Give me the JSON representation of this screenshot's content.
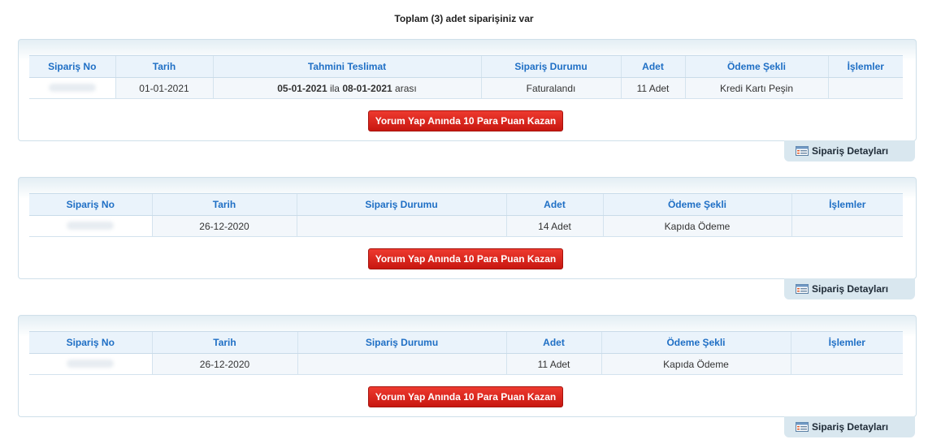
{
  "summary": "Toplam (3) adet siparişiniz var",
  "orders": [
    {
      "headers": [
        "Sipariş No",
        "Tarih",
        "Tahmini Teslimat",
        "Sipariş Durumu",
        "Adet",
        "Ödeme Şekli",
        "İşlemler"
      ],
      "row": {
        "order_no": "",
        "date": "01-01-2021",
        "delivery_start": "05-01-2021",
        "delivery_mid": " ila ",
        "delivery_end": "08-01-2021",
        "delivery_suffix": " arası",
        "status": "Faturalandı",
        "quantity": "11 Adet",
        "payment": "Kredi Kartı Peşin",
        "actions": ""
      },
      "promo_label": "Yorum Yap Anında 10 Para Puan Kazan",
      "details_label": "Sipariş Detayları"
    },
    {
      "headers": [
        "Sipariş No",
        "Tarih",
        "Sipariş Durumu",
        "Adet",
        "Ödeme Şekli",
        "İşlemler"
      ],
      "row": {
        "order_no": "",
        "date": "26-12-2020",
        "status": "",
        "quantity": "14 Adet",
        "payment": "Kapıda Ödeme",
        "actions": ""
      },
      "promo_label": "Yorum Yap Anında 10 Para Puan Kazan",
      "details_label": "Sipariş Detayları"
    },
    {
      "headers": [
        "Sipariş No",
        "Tarih",
        "Sipariş Durumu",
        "Adet",
        "Ödeme Şekli",
        "İşlemler"
      ],
      "row": {
        "order_no": "",
        "date": "26-12-2020",
        "status": "",
        "quantity": "11 Adet",
        "payment": "Kapıda Ödeme",
        "actions": ""
      },
      "promo_label": "Yorum Yap Anında 10 Para Puan Kazan",
      "details_label": "Sipariş Detayları"
    }
  ],
  "icons": {
    "details": "list-window-icon"
  },
  "colors": {
    "header_text": "#1f6fc5",
    "promo_button": "#d9261c",
    "tab_background": "#d9e7ef"
  }
}
